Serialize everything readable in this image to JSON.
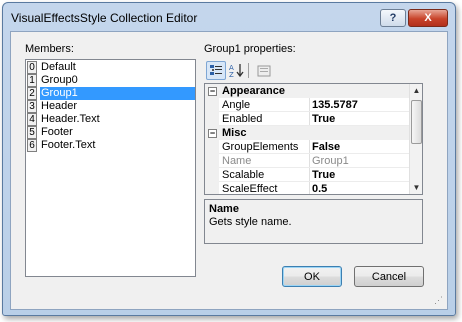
{
  "window": {
    "title": "VisualEffectsStyle Collection Editor",
    "help_label": "?",
    "close_label": "X"
  },
  "members": {
    "label": "Members:",
    "items": [
      {
        "index": "0",
        "name": "Default"
      },
      {
        "index": "1",
        "name": "Group0"
      },
      {
        "index": "2",
        "name": "Group1"
      },
      {
        "index": "3",
        "name": "Header"
      },
      {
        "index": "4",
        "name": "Header.Text"
      },
      {
        "index": "5",
        "name": "Footer"
      },
      {
        "index": "6",
        "name": "Footer.Text"
      }
    ],
    "selected_index": 2
  },
  "properties": {
    "label": "Group1 properties:",
    "toolbar": {
      "categorized_icon": "categorized-icon",
      "alphabetical_icon": "alphabetical-icon",
      "property_pages_icon": "property-pages-icon"
    },
    "grid": {
      "categories": [
        {
          "name": "Appearance",
          "toggle": "−",
          "rows": [
            {
              "name": "Angle",
              "value": "135.5787"
            },
            {
              "name": "Enabled",
              "value": "True"
            }
          ]
        },
        {
          "name": "Misc",
          "toggle": "−",
          "rows": [
            {
              "name": "GroupElements",
              "value": "False"
            },
            {
              "name": "Name",
              "value": "Group1"
            },
            {
              "name": "Scalable",
              "value": "True"
            },
            {
              "name": "ScaleEffect",
              "value": "0.5"
            }
          ]
        }
      ]
    },
    "description": {
      "title": "Name",
      "text": "Gets style name."
    }
  },
  "buttons": {
    "ok": "OK",
    "cancel": "Cancel"
  }
}
